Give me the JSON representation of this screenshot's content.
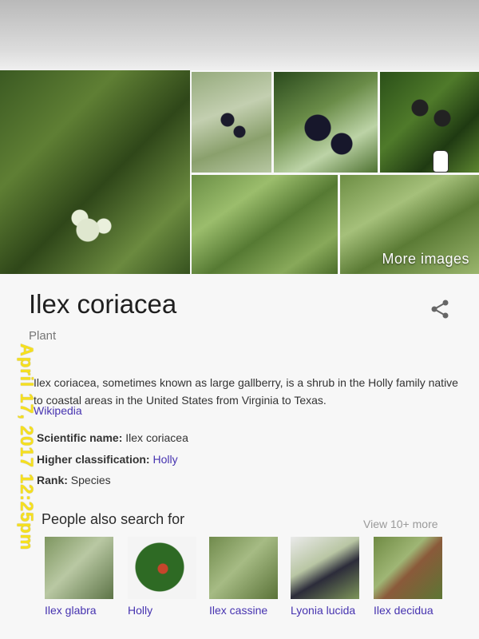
{
  "images": {
    "more_images_label": "More images"
  },
  "entity": {
    "title": "Ilex coriacea",
    "subtitle": "Plant",
    "description": "Ilex coriacea, sometimes known as large gallberry, is a shrub in the Holly family native to coastal areas in the United States from Virginia to Texas.",
    "source_link": "Wikipedia"
  },
  "facts": [
    {
      "key": "Scientific name: ",
      "value": "Ilex coriacea",
      "is_link": false
    },
    {
      "key": "Higher classification: ",
      "value": "Holly",
      "is_link": true
    },
    {
      "key": "Rank: ",
      "value": "Species",
      "is_link": false
    }
  ],
  "people_also_search": {
    "title": "People also search for",
    "view_more": "View 10+ more",
    "items": [
      {
        "label": "Ilex glabra"
      },
      {
        "label": "Holly"
      },
      {
        "label": "Ilex cassine"
      },
      {
        "label": "Lyonia lucida"
      },
      {
        "label": "Ilex decidua"
      }
    ]
  },
  "overlay": {
    "date_stamp": "April 17, 2017 12:25pm"
  },
  "colors": {
    "link": "#4633b0",
    "stamp": "#f6e01e"
  }
}
